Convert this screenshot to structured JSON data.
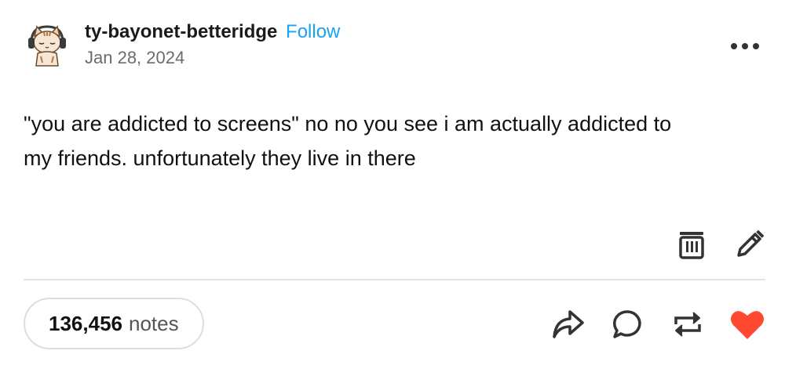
{
  "post": {
    "username": "ty-bayonet-betteridge",
    "follow_label": "Follow",
    "date": "Jan 28, 2024",
    "body_line1": "\"you are addicted to screens\" no no you see i am actually addicted to",
    "body_line2": "my friends. unfortunately they live in there"
  },
  "footer": {
    "notes_count": "136,456",
    "notes_label": "notes"
  },
  "icons": {
    "avatar": "avatar-cat-with-headphones",
    "more": "more-options-icon",
    "delete": "trash-icon",
    "edit": "pencil-icon",
    "share": "share-arrow-icon",
    "reply": "speech-bubble-icon",
    "reblog": "reblog-icon",
    "like": "heart-icon"
  },
  "colors": {
    "follow": "#1aa3f0",
    "heart": "#ff4930",
    "text": "#121212",
    "muted": "#6b6b6b"
  }
}
